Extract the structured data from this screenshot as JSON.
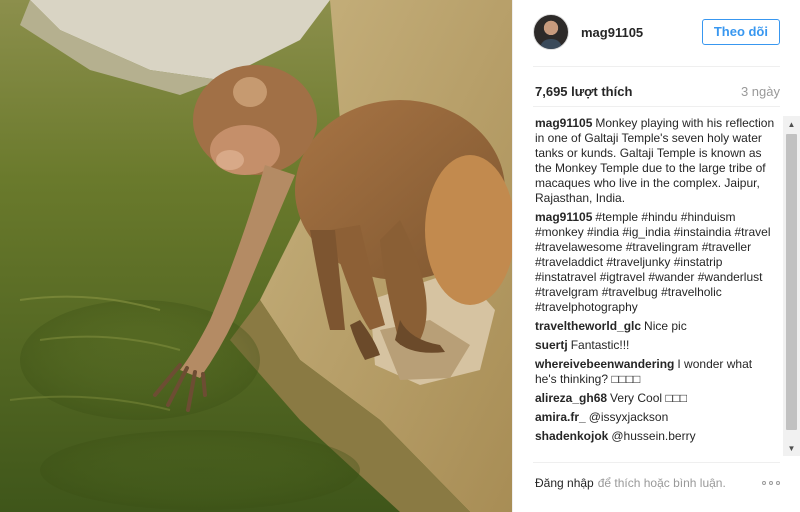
{
  "post": {
    "username": "mag91105",
    "follow_label": "Theo dõi",
    "likes": "7,695 lượt thích",
    "time": "3 ngày",
    "caption": {
      "user": "mag91105",
      "text": "Monkey playing with his reflection in one of Galtaji Temple's seven holy water tanks or kunds. Galtaji Temple is known as the Monkey Temple due to the large tribe of macaques who live in the complex. Jaipur, Rajasthan, India."
    },
    "comments": [
      {
        "user": "mag91105",
        "text": "#temple #hindu #hinduism #monkey #india #ig_india #instaindia #travel #travelawesome #travelingram #traveller #traveladdict #traveljunky #instatrip #instatravel #igtravel #wander #wanderlust #travelgram #travelbug #travelholic #travelphotography"
      },
      {
        "user": "traveltheworld_glc",
        "text": "Nice pic"
      },
      {
        "user": "suertj",
        "text": "Fantastic!!!"
      },
      {
        "user": "whereivebeenwandering",
        "text": "I wonder what he's thinking? □□□□"
      },
      {
        "user": "alireza_gh68",
        "text": "Very Cool □□□"
      },
      {
        "user": "amira.fr_",
        "text": "@issyxjackson"
      },
      {
        "user": "shadenkojok",
        "text": "@hussein.berry"
      }
    ],
    "footer": {
      "login_label": "Đăng nhập",
      "rest": "để thích hoặc bình luận."
    }
  },
  "icons": {
    "more": "more-options-icon",
    "scroll_up": "scroll-up-arrow-icon",
    "scroll_down": "scroll-down-arrow-icon"
  },
  "colors": {
    "accent": "#3897f0",
    "text": "#262626",
    "muted": "#999999",
    "water": "#5f6b25",
    "monkey_fur": "#9a6a3e"
  }
}
